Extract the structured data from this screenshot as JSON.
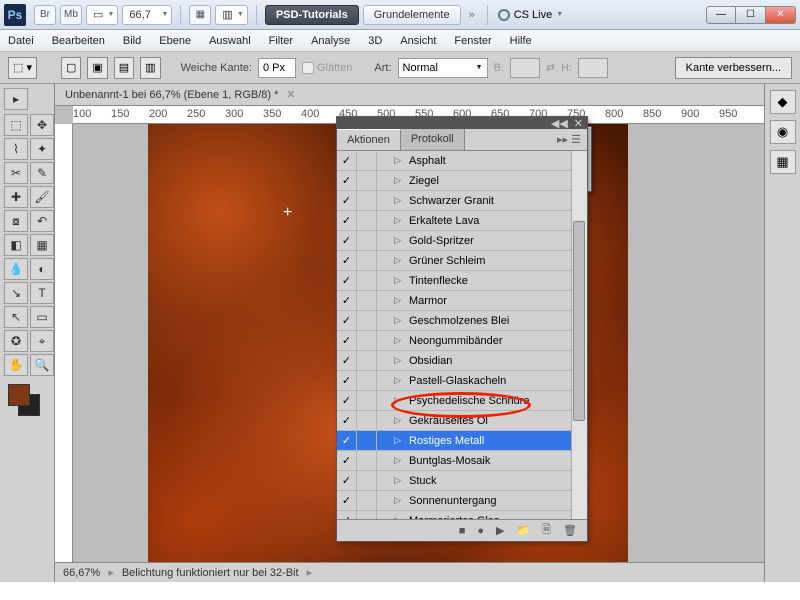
{
  "title": {
    "zoom": "66,7",
    "btn_psd": "PSD-Tutorials",
    "btn_grund": "Grundelemente",
    "cslive": "CS Live"
  },
  "menu": [
    "Datei",
    "Bearbeiten",
    "Bild",
    "Ebene",
    "Auswahl",
    "Filter",
    "Analyse",
    "3D",
    "Ansicht",
    "Fenster",
    "Hilfe"
  ],
  "opt": {
    "weiche": "Weiche Kante:",
    "px": "0 Px",
    "glatten": "Glätten",
    "art": "Art:",
    "art_val": "Normal",
    "b": "B:",
    "h": "H:",
    "verb": "Kante verbessern..."
  },
  "doc_tab": "Unbenannt-1 bei 66,7% (Ebene 1, RGB/8) *",
  "ruler_marks": [
    "100",
    "150",
    "200",
    "250",
    "300",
    "350",
    "400",
    "450",
    "500",
    "550",
    "600",
    "650",
    "700",
    "750",
    "800",
    "850",
    "900",
    "950"
  ],
  "status": {
    "zoom": "66,67%",
    "msg": "Belichtung funktioniert nur bei 32-Bit"
  },
  "panel": {
    "tab1": "Aktionen",
    "tab2": "Protokoll",
    "items": [
      "Asphalt",
      "Ziegel",
      "Schwarzer Granit",
      "Erkaltete Lava",
      "Gold-Spritzer",
      "Grüner Schleim",
      "Tintenflecke",
      "Marmor",
      "Geschmolzenes Blei",
      "Neongummibänder",
      "Obsidian",
      "Pastell-Glaskacheln",
      "Psychedelische Schnüre",
      "Gekräuseltes Öl",
      "Rostiges Metall",
      "Buntglas-Mosaik",
      "Stuck",
      "Sonnenuntergang",
      "Marmoriertes Glas"
    ],
    "selected": 14
  }
}
